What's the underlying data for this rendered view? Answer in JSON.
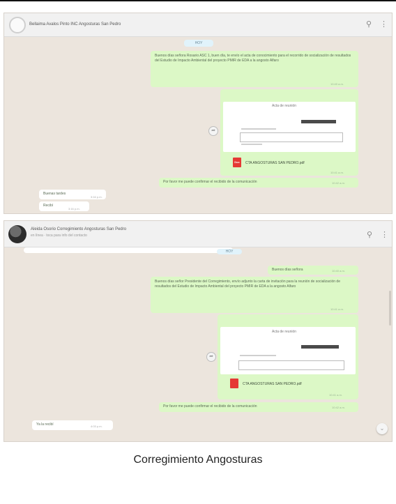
{
  "shot1": {
    "title": "Bellaima Avalos Pinto INC Angosturas San Pedro",
    "date_label": "HOY",
    "msg1": "Buenos días señora Rosario ASC 1, buen día, te envío el acta de conocimiento para el recorrido de socialización de resultados del Estudio de Impacto Ambiental del proyecto PMIR de EDA a la angosto Alfaro",
    "msg1_time": "10:40 a.m.",
    "doc_header": "Acta de reunión",
    "doc_label": "Doc",
    "file_name": "CTA ANGOSTURAS SAN PEDRO.pdf",
    "file_time": "10:41 a.m.",
    "msg2": "Por favor me puede confirmar el recibido de la comunicación",
    "msg2_time": "10:42 a.m.",
    "in1": "Buenas tardes",
    "in1_time": "3:16 p.m.",
    "in2": "Recibí",
    "in2_time": "3:16 p.m.",
    "icons": {
      "search": "search-icon",
      "menu": "more-icon"
    }
  },
  "shot2": {
    "title": "Aleida Osorio Corregimiento Angosturas San Pedro",
    "subtitle": "en línea · toca para info del contacto",
    "date_label": "HOY",
    "greet": "Buenos días señora",
    "greet_time": "10:40 a.m.",
    "msg1": "Buenos días señor Presidente del Corregimiento, envío adjunto la carta de invitación para la reunión de socialización de resultados del Estudio de Impacto Ambiental del proyecto PMIR de EDA a la angosto Alfaro",
    "msg1_time": "10:41 a.m.",
    "doc_header": "Acta de reunión",
    "file_name": "CTA ANGOSTURAS SAN PEDRO.pdf",
    "file_time": "10:41 a.m.",
    "msg2": "Por favor me puede confirmar el recibido de la comunicación",
    "msg2_time": "10:42 a.m.",
    "in1": "Ya la recibí",
    "in1_time": "4:03 p.m.",
    "scroll_glyph": "⌄",
    "icons": {
      "search": "search-icon",
      "menu": "more-icon"
    }
  },
  "caption": "Corregimiento Angosturas"
}
